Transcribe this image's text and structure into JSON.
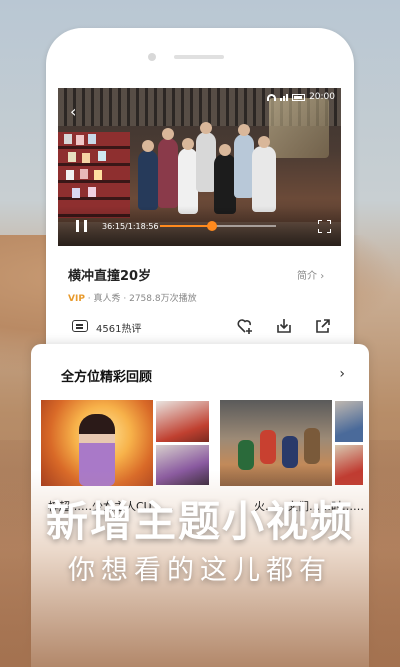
{
  "status_bar": {
    "time": "20:00"
  },
  "player": {
    "elapsed": "36:15/1:18:56",
    "progress": 0.45,
    "accent": "#ff8a1e"
  },
  "show": {
    "title": "横冲直撞20岁",
    "intro_label": "简介",
    "vip_badge": "VIP",
    "meta": "· 真人秀 · 2758.8万次播放",
    "comments": "4561热评"
  },
  "actions": {
    "icons": [
      "comment-icon",
      "add-favorite-icon",
      "download-icon",
      "share-icon"
    ]
  },
  "review": {
    "title": "全方位精彩回顾",
    "captions": [
      "梓超……少女主人CU……",
      "火……文们……时……"
    ]
  },
  "promo": {
    "headline": "新增主题小视频",
    "subline": "你想看的这儿都有"
  }
}
